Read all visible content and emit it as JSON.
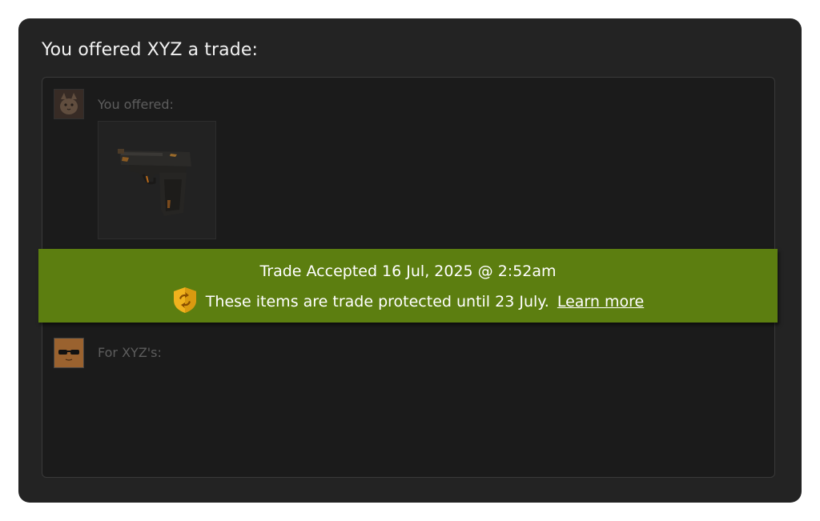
{
  "heading": "You offered XYZ a trade:",
  "my_side": {
    "label": "You offered:",
    "items": [
      {
        "icon": "pistol-icon"
      }
    ]
  },
  "their_side": {
    "label": "For XYZ's:"
  },
  "banner": {
    "status": "Trade Accepted 16 Jul, 2025 @ 2:52am",
    "protection_text": "These items are trade protected until 23 July.",
    "learn_more": "Learn more",
    "icon": "trade-protected-shield-icon"
  },
  "colors": {
    "banner_green": "#5c7e10",
    "shield_gold": "#f0b21d"
  }
}
